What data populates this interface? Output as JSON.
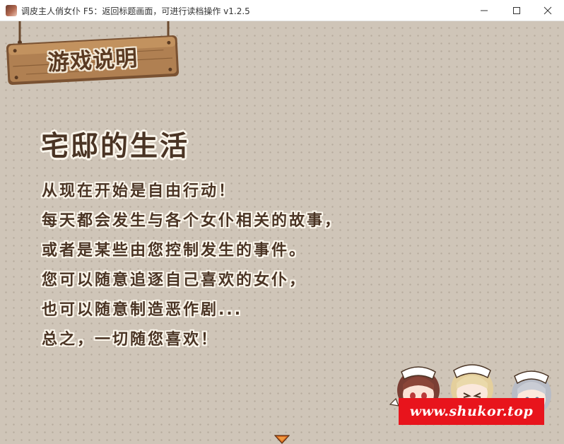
{
  "window": {
    "title": "调皮主人俏女仆    F5：返回标题画面，可进行读档操作 v1.2.5",
    "controls": [
      "minimize",
      "maximize",
      "close"
    ]
  },
  "sign": {
    "label": "游戏说明"
  },
  "content": {
    "heading": "宅邸的生活",
    "lines": [
      "从现在开始是自由行动！",
      "每天都会发生与各个女仆相关的故事，",
      "或者是某些由您控制发生的事件。",
      "您可以随意追逐自己喜欢的女仆，",
      "也可以随意制造恶作剧...",
      "总之，一切随您喜欢！"
    ]
  },
  "watermark": {
    "text": "www.shukor.top"
  },
  "icons": {
    "app": "app-icon",
    "next": "next-page-arrow-icon"
  },
  "colors": {
    "background": "#cfc5b8",
    "text": "#4a3424",
    "text_outline": "#fbf6ec",
    "sign_wood": "#a9784a",
    "watermark": "#e8141c"
  }
}
